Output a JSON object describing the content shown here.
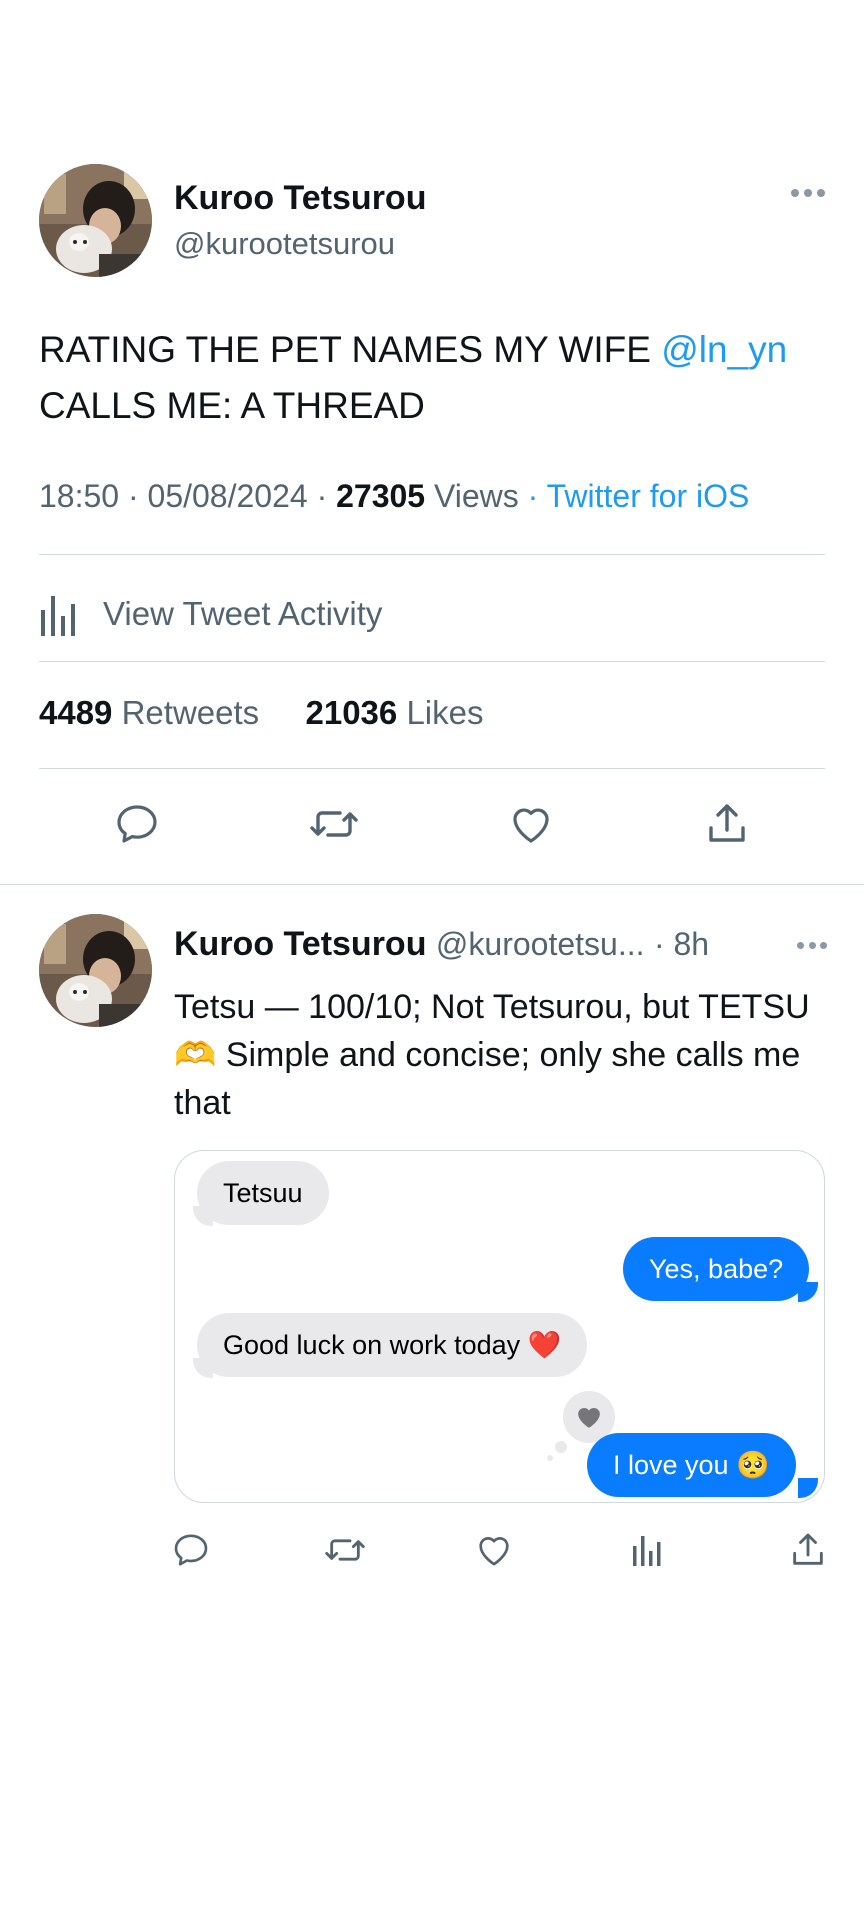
{
  "tweet": {
    "author_name": "Kuroo Tetsurou",
    "author_handle": "@kurootetsurou",
    "text_before": "RATING THE PET NAMES MY WIFE ",
    "mention": "@ln_yn",
    "text_after": " CALLS ME: A THREAD",
    "time": "18:50",
    "date": "05/08/2024",
    "views_count": "27305",
    "views_label": "Views",
    "source": "Twitter for iOS",
    "activity_label": "View Tweet Activity",
    "retweets_count": "4489",
    "retweets_label": "Retweets",
    "likes_count": "21036",
    "likes_label": "Likes"
  },
  "reply": {
    "author_name": "Kuroo Tetsurou",
    "author_handle": "@kurootetsu...",
    "age": "8h",
    "text": "Tetsu — 100/10; Not Tetsurou, but TETSU 🫶 Simple and concise; only she calls me that",
    "messages": [
      {
        "from": "them",
        "text": "Tetsuu"
      },
      {
        "from": "me",
        "text": "Yes, babe?"
      },
      {
        "from": "them",
        "text": "Good luck on work today ❤️"
      },
      {
        "from": "me",
        "text": "I love you 🥺"
      }
    ]
  },
  "colors": {
    "link": "#1d9bf0",
    "text_primary": "#0f1419",
    "text_secondary": "#536471",
    "divider": "#cfd9de",
    "imessage_blue": "#0a7cff",
    "imessage_gray": "#e9e9eb"
  },
  "icons": [
    "more-icon",
    "analytics-icon",
    "reply-icon",
    "retweet-icon",
    "like-icon",
    "share-icon",
    "heart-reaction-icon"
  ]
}
